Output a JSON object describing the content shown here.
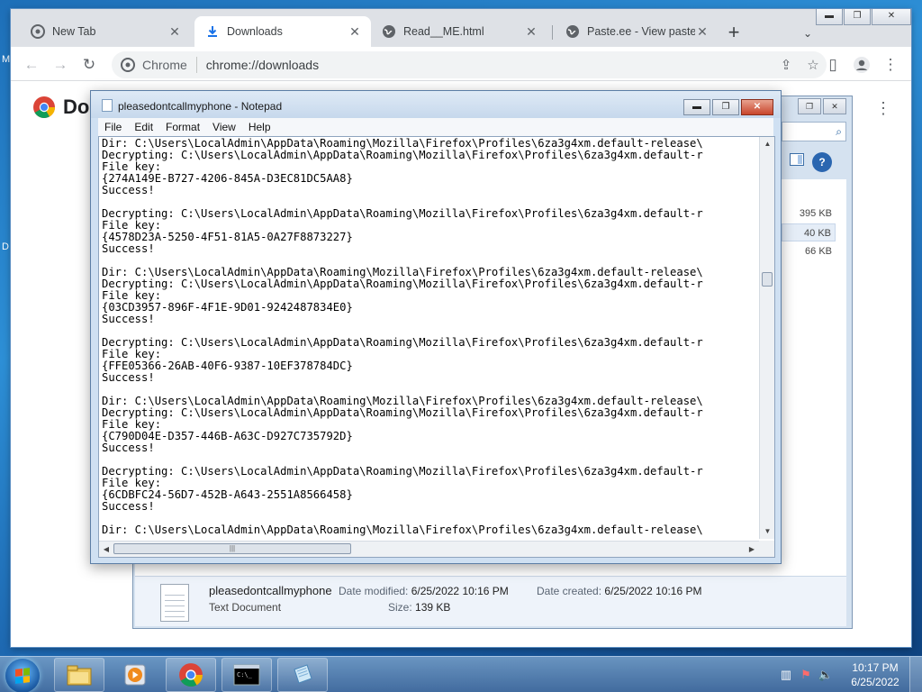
{
  "desktop": {
    "stray_left": "M",
    "stray_left2": "D"
  },
  "browser": {
    "tabs": [
      {
        "label": "New Tab",
        "icon": "chrome-icon"
      },
      {
        "label": "Downloads",
        "icon": "download-icon"
      },
      {
        "label": "Read__ME.html",
        "icon": "globe-icon"
      },
      {
        "label": "Paste.ee - View paste iy",
        "icon": "globe-icon"
      }
    ],
    "newtab_symbol": "+",
    "tablist_symbol": "⌄",
    "window_buttons": {
      "minimize": "▬",
      "restore": "❐",
      "close": "✕"
    },
    "nav": {
      "back": "←",
      "forward": "→",
      "reload": "↻"
    },
    "omnibox": {
      "site_label": "Chrome",
      "url": "chrome://downloads"
    },
    "page": {
      "title_visible": "Do",
      "menu": "⋮"
    }
  },
  "explorer": {
    "search_glyph": "⌕",
    "sizes": [
      "395 KB",
      "40 KB",
      "66 KB"
    ],
    "help": "?",
    "details": {
      "name": "pleasedontcallmyphone",
      "type": "Text Document",
      "modified_label": "Date modified:",
      "modified_value": "6/25/2022 10:16 PM",
      "created_label": "Date created:",
      "created_value": "6/25/2022 10:16 PM",
      "size_label": "Size:",
      "size_value": "139 KB"
    }
  },
  "notepad": {
    "title": "pleasedontcallmyphone - Notepad",
    "menu": [
      "File",
      "Edit",
      "Format",
      "View",
      "Help"
    ],
    "lines": [
      "Dir: C:\\Users\\LocalAdmin\\AppData\\Roaming\\Mozilla\\Firefox\\Profiles\\6za3g4xm.default-release\\",
      "Decrypting: C:\\Users\\LocalAdmin\\AppData\\Roaming\\Mozilla\\Firefox\\Profiles\\6za3g4xm.default-r",
      "File key:",
      "{274A149E-B727-4206-845A-D3EC81DC5AA8}",
      "Success!",
      "",
      "Decrypting: C:\\Users\\LocalAdmin\\AppData\\Roaming\\Mozilla\\Firefox\\Profiles\\6za3g4xm.default-r",
      "File key:",
      "{4578D23A-5250-4F51-81A5-0A27F8873227}",
      "Success!",
      "",
      "Dir: C:\\Users\\LocalAdmin\\AppData\\Roaming\\Mozilla\\Firefox\\Profiles\\6za3g4xm.default-release\\",
      "Decrypting: C:\\Users\\LocalAdmin\\AppData\\Roaming\\Mozilla\\Firefox\\Profiles\\6za3g4xm.default-r",
      "File key:",
      "{03CD3957-896F-4F1E-9D01-9242487834E0}",
      "Success!",
      "",
      "Decrypting: C:\\Users\\LocalAdmin\\AppData\\Roaming\\Mozilla\\Firefox\\Profiles\\6za3g4xm.default-r",
      "File key:",
      "{FFE05366-26AB-40F6-9387-10EF378784DC}",
      "Success!",
      "",
      "Dir: C:\\Users\\LocalAdmin\\AppData\\Roaming\\Mozilla\\Firefox\\Profiles\\6za3g4xm.default-release\\",
      "Decrypting: C:\\Users\\LocalAdmin\\AppData\\Roaming\\Mozilla\\Firefox\\Profiles\\6za3g4xm.default-r",
      "File key:",
      "{C790D04E-D357-446B-A63C-D927C735792D}",
      "Success!",
      "",
      "Decrypting: C:\\Users\\LocalAdmin\\AppData\\Roaming\\Mozilla\\Firefox\\Profiles\\6za3g4xm.default-r",
      "File key:",
      "{6CDBFC24-56D7-452B-A643-2551A8566458}",
      "Success!",
      "",
      "Dir: C:\\Users\\LocalAdmin\\AppData\\Roaming\\Mozilla\\Firefox\\Profiles\\6za3g4xm.default-release\\"
    ],
    "buttons": {
      "minimize": "▬",
      "maximize": "❐",
      "close": "✕"
    }
  },
  "taskbar": {
    "items": [
      "explorer-icon",
      "media-player-icon",
      "chrome-icon",
      "cmd-icon",
      "notepad-icon"
    ],
    "clock_time": "10:17 PM",
    "clock_date": "6/25/2022"
  }
}
